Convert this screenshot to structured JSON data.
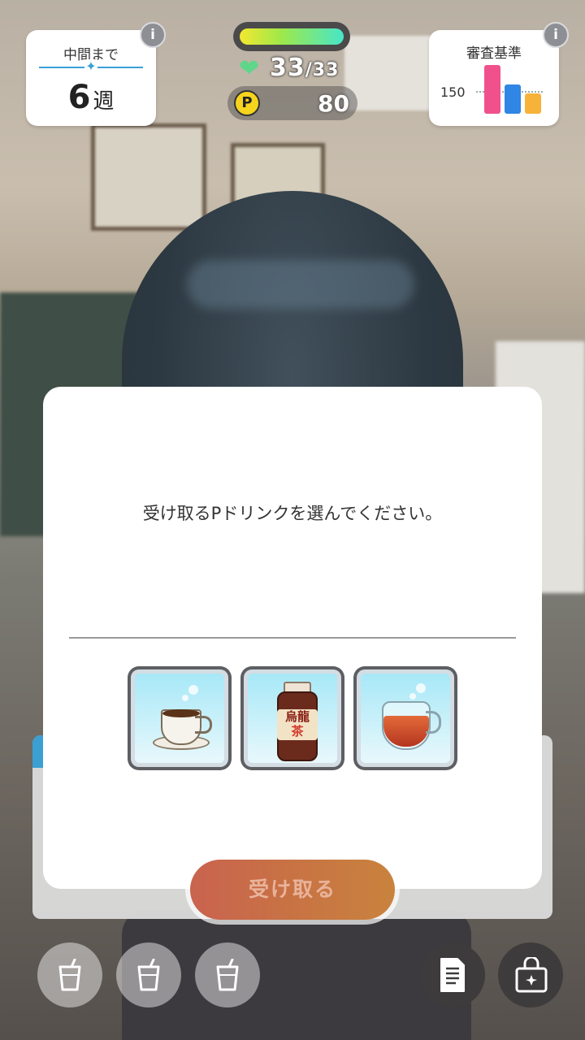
{
  "hud": {
    "midterm_label": "中間まで",
    "weeks_value": "6",
    "weeks_unit": "週",
    "criteria_title": "審査基準",
    "criteria_value": "150",
    "criteria_bars": [
      {
        "color": "#f0518c",
        "level": 0.85
      },
      {
        "color": "#2f86e4",
        "level": 0.52
      },
      {
        "color": "#f7b23a",
        "level": 0.35
      }
    ],
    "hp_current": "33",
    "hp_separator": "/",
    "hp_max": "33",
    "hp_fill": 1.0,
    "p_symbol": "P",
    "p_value": "80",
    "info_glyph": "i"
  },
  "dialog": {
    "prompt": "受け取るPドリンクを選んでください。",
    "drinks": [
      {
        "name": "coffee",
        "icon": "coffee-cup-icon"
      },
      {
        "name": "oolong tea",
        "icon": "oolong-bottle-icon",
        "label_top": "烏龍",
        "label_bottom": "茶"
      },
      {
        "name": "black tea",
        "icon": "tea-glass-icon"
      }
    ]
  },
  "receive_button": {
    "label": "受け取る"
  },
  "bottom_bar": {
    "drink_slots": [
      "drink-slot-empty",
      "drink-slot-empty",
      "drink-slot-empty"
    ],
    "memo_icon": "document-icon",
    "bag_icon": "bag-icon"
  },
  "colors": {
    "accent_blue": "#3aa0d8",
    "button_orange": "#c87443",
    "heart_green": "#5fd68a",
    "coin_yellow": "#f6d31d"
  }
}
